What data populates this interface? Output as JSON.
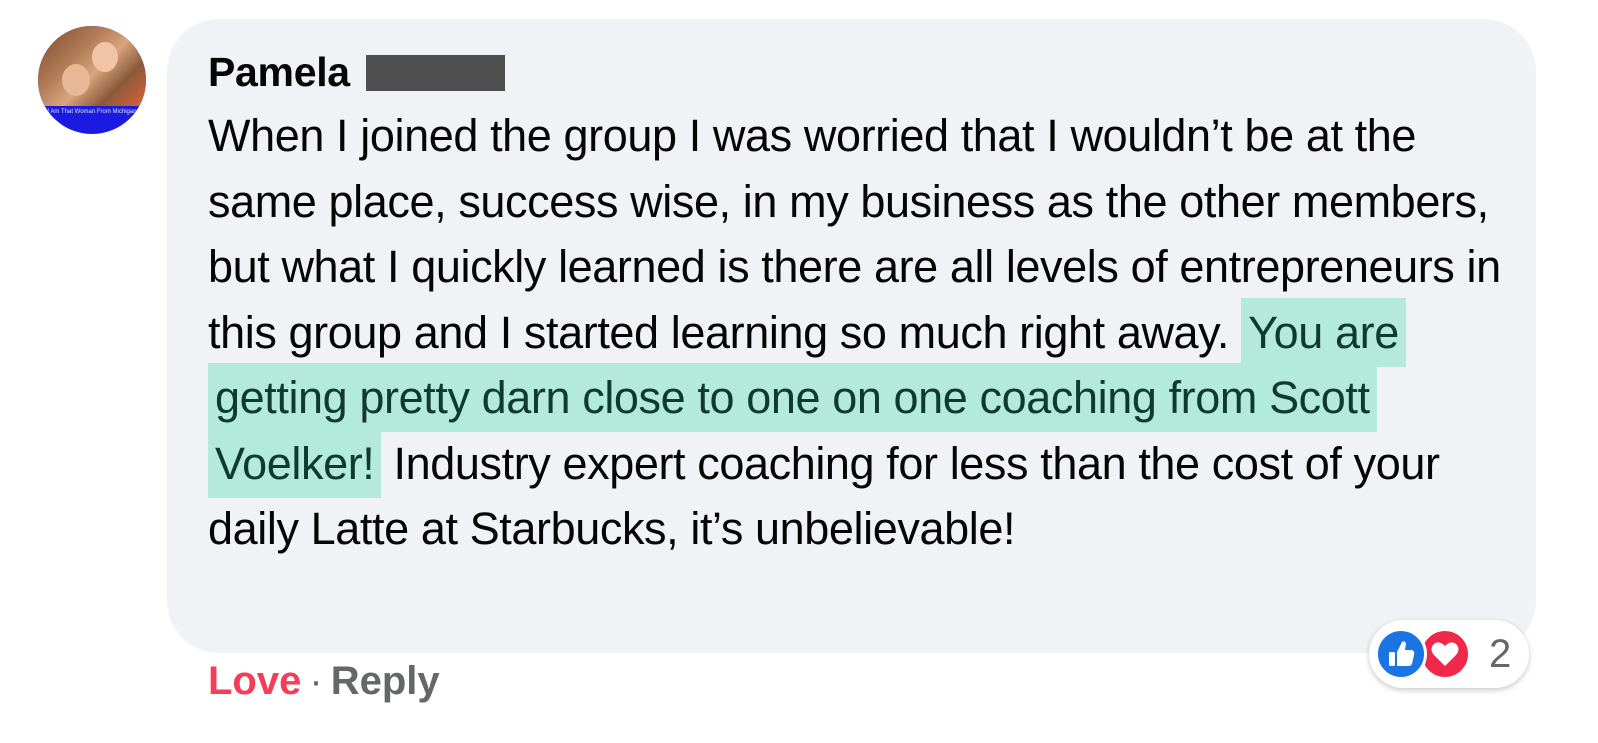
{
  "comment": {
    "author": "Pamela",
    "avatar_caption": "I Am That Woman From Michigan",
    "text_before": "When I joined the group I was worried that I wouldn’t be at the same place, success wise, in my business as the other members, but what I quickly learned is there are all levels of entrepreneurs in this group and I started learning so much right away. ",
    "text_highlight": "You are getting pretty darn close to one on one coaching from Scott Voelker!",
    "text_after": " Industry expert coaching for less than the cost of your daily Latte at Starbucks, it’s unbelievable!",
    "highlight_color": "#b4ead9"
  },
  "actions": {
    "love_label": "Love",
    "separator": "·",
    "reply_label": "Reply",
    "love_color": "#f33e58"
  },
  "reactions": {
    "icons": [
      "like-icon",
      "love-icon"
    ],
    "count": "2"
  },
  "colors": {
    "bubble_background": "#f0f2f5",
    "like_blue": "#1b74e4",
    "love_red": "#f0284a"
  }
}
